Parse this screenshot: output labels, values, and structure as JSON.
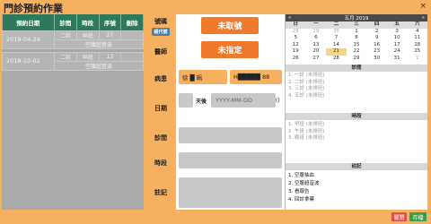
{
  "title": "門診預約作業",
  "close": "×",
  "list": {
    "headers": [
      "預約日期",
      "診間",
      "時段",
      "序號",
      "刪除"
    ],
    "records": [
      {
        "date": "2019-04-24",
        "clinic": "二診",
        "slot": "早班",
        "seq": "27",
        "service": "空腹超音波"
      },
      {
        "date": "2018-10-02",
        "clinic": "二診",
        "slot": "早班",
        "seq": "13",
        "service": "空腹超音波"
      }
    ]
  },
  "form": {
    "labels": {
      "number": "號碼",
      "doctor": "醫師",
      "record": "病患",
      "date": "日期",
      "clinic": "診間",
      "slot": "時段",
      "note": "註記"
    },
    "group_button": "組代號",
    "number_btn": "未取號",
    "doctor_btn": "未指定",
    "patient_name": "徐 █ 珮",
    "patient_id": "H█████ 88",
    "days_label": "天後",
    "date_placeholder": "YYYY-MM-DD",
    "date_paren": "()"
  },
  "calendar": {
    "prev": "«",
    "title": "五月 2019",
    "next": "»",
    "weekdays": [
      "日",
      "一",
      "二",
      "三",
      "四",
      "五",
      "六"
    ],
    "weeks": [
      [
        "28",
        "29",
        "30",
        "1",
        "2",
        "3",
        "4"
      ],
      [
        "5",
        "6",
        "7",
        "8",
        "9",
        "10",
        "11"
      ],
      [
        "12",
        "13",
        "14",
        "15",
        "16",
        "17",
        "18"
      ],
      [
        "19",
        "20",
        "21",
        "22",
        "23",
        "24",
        "25"
      ],
      [
        "26",
        "27",
        "28",
        "29",
        "30",
        "31",
        "1"
      ]
    ],
    "today": "21"
  },
  "clinic_section": {
    "title": "診間",
    "items": [
      "1. 一診 (未排班)",
      "2. 二診 (未排班)",
      "3. 三診 (未排班)",
      "4. 五診 (未排班)"
    ]
  },
  "slot_section": {
    "title": "時段",
    "items": [
      "1. 早班 (未排班)",
      "2. 午班 (未排班)",
      "3. 晚班 (未排班)"
    ]
  },
  "note_section": {
    "title": "註記",
    "items": [
      "1. 空腹抽血",
      "2. 空腹超音波",
      "3. 看報告",
      "4. 回診拿藥"
    ]
  },
  "footer": {
    "close": "關閉",
    "save": "存檔"
  },
  "colors": {
    "orange": "#f5b060",
    "accent": "#ef7a2c",
    "green_header": "#2c7a59",
    "close_btn": "#d9534f",
    "save_btn": "#3f9b45"
  }
}
